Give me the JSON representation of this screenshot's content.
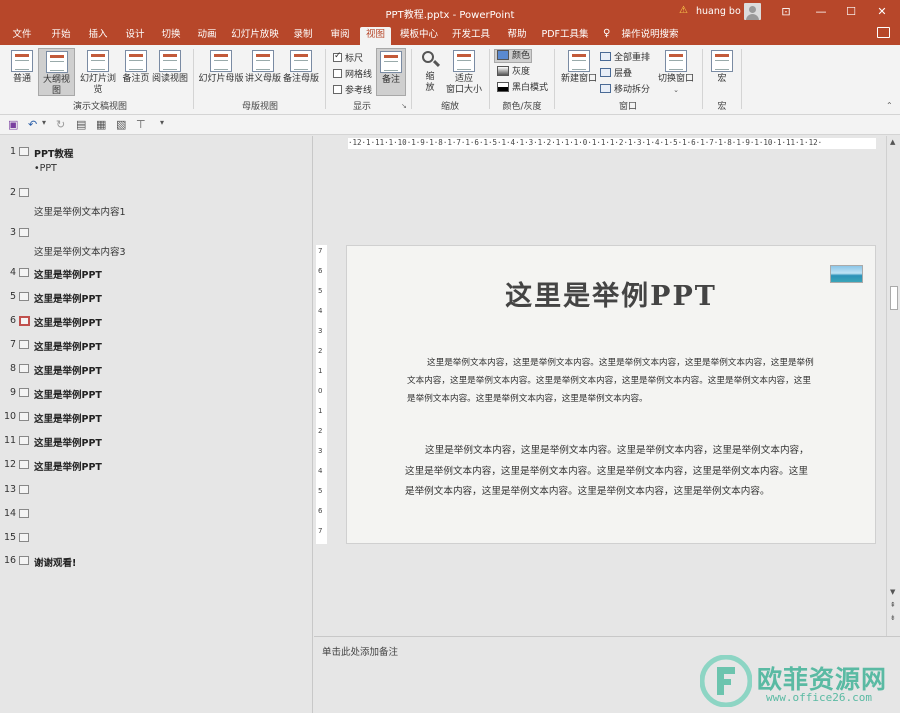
{
  "window": {
    "title": "PPT教程.pptx  -  PowerPoint",
    "user": "huang bo",
    "controls": [
      "⊡",
      "—",
      "☐",
      "✕"
    ]
  },
  "ribbon_tabs": [
    "文件",
    "开始",
    "插入",
    "设计",
    "切换",
    "动画",
    "幻灯片放映",
    "录制",
    "审阅",
    "视图",
    "模板中心",
    "开发工具",
    "帮助",
    "PDF工具集",
    "操作说明搜索"
  ],
  "active_tab": "视图",
  "ribbon": {
    "presentation_views": {
      "label": "演示文稿视图",
      "buttons": [
        "普通",
        "大纲视图",
        "幻灯片浏览",
        "备注页",
        "阅读视图"
      ]
    },
    "master_views": {
      "label": "母版视图",
      "buttons": [
        "幻灯片母版",
        "讲义母版",
        "备注母版"
      ]
    },
    "show": {
      "label": "显示",
      "ruler": "标尺",
      "gridlines": "网格线",
      "guides": "参考线",
      "notes": "备注"
    },
    "zoom": {
      "label": "缩放",
      "zoom_line1": "缩",
      "zoom_line2": "放",
      "fit_line1": "适应",
      "fit_line2": "窗口大小"
    },
    "color": {
      "label": "颜色/灰度",
      "color": "颜色",
      "grayscale": "灰度",
      "bw": "黑白模式"
    },
    "window": {
      "label": "窗口",
      "new_window": "新建窗口",
      "arrange_all": "全部重排",
      "cascade": "层叠",
      "move_split": "移动拆分",
      "switch_windows": "切换窗口"
    },
    "macros": {
      "label": "宏",
      "button": "宏"
    }
  },
  "outline": [
    {
      "num": "1",
      "title": "PPT教程",
      "sub": "•PPT"
    },
    {
      "num": "2",
      "title": "",
      "sub": "这里是举例文本内容1"
    },
    {
      "num": "3",
      "title": "",
      "sub": "这里是举例文本内容3"
    },
    {
      "num": "4",
      "title": "这里是举例PPT"
    },
    {
      "num": "5",
      "title": "这里是举例PPT"
    },
    {
      "num": "6",
      "title": "这里是举例PPT"
    },
    {
      "num": "7",
      "title": "这里是举例PPT"
    },
    {
      "num": "8",
      "title": "这里是举例PPT"
    },
    {
      "num": "9",
      "title": "这里是举例PPT"
    },
    {
      "num": "10",
      "title": "这里是举例PPT"
    },
    {
      "num": "11",
      "title": "这里是举例PPT"
    },
    {
      "num": "12",
      "title": "这里是举例PPT"
    },
    {
      "num": "13",
      "title": ""
    },
    {
      "num": "14",
      "title": ""
    },
    {
      "num": "15",
      "title": ""
    },
    {
      "num": "16",
      "title": "谢谢观看!"
    }
  ],
  "selected_slide": "6",
  "ruler": {
    "horizontal": "·12·1·11·1·10·1·9·1·8·1·7·1·6·1·5·1·4·1·3·1·2·1·1·1·0·1·1·1·2·1·3·1·4·1·5·1·6·1·7·1·8·1·9·1·10·1·11·1·12·",
    "vertical": [
      "7",
      "6",
      "5",
      "4",
      "3",
      "2",
      "1",
      "0",
      "1",
      "2",
      "3",
      "4",
      "5",
      "6",
      "7"
    ]
  },
  "slide": {
    "title": "这里是举例PPT",
    "paragraph1": "这里是举例文本内容，这里是举例文本内容。这里是举例文本内容，这里是举例文本内容，这里是举例文本内容，这里是举例文本内容。这里是举例文本内容，这里是举例文本内容。这里是举例文本内容，这里是举例文本内容。这里是举例文本内容，这里是举例文本内容。",
    "paragraph2": "这里是举例文本内容，这里是举例文本内容。这里是举例文本内容，这里是举例文本内容，这里是举例文本内容，这里是举例文本内容。这里是举例文本内容，这里是举例文本内容。这里是举例文本内容，这里是举例文本内容。这里是举例文本内容，这里是举例文本内容。"
  },
  "notes_placeholder": "单击此处添加备注",
  "watermark": {
    "name": "欧菲资源网",
    "url": "www.office26.com"
  }
}
